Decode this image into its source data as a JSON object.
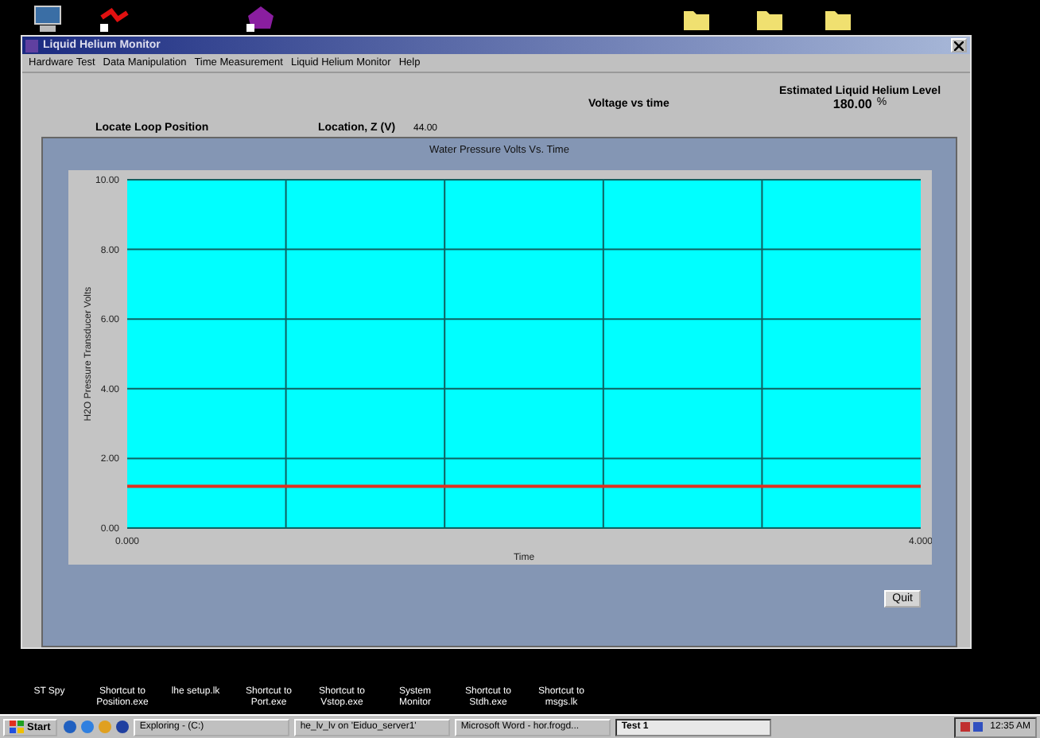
{
  "desktop_icons": [
    {
      "kind": "computer"
    },
    {
      "kind": "network"
    },
    {
      "kind": "app"
    },
    {
      "kind": "folder"
    },
    {
      "kind": "folder"
    },
    {
      "kind": "folder"
    }
  ],
  "window": {
    "title": "Liquid Helium Monitor",
    "menu": [
      "Hardware Test",
      "Data Manipulation",
      "Time Measurement",
      "Liquid Helium Monitor",
      "Help"
    ]
  },
  "header": {
    "locate_label": "Locate Loop Position",
    "location_label": "Location, Z (V)",
    "location_value": "44.00",
    "voltage_label": "Voltage vs time",
    "level_label": "Estimated Liquid Helium Level",
    "level_value": "180.00",
    "level_unit": "%"
  },
  "chart_data": {
    "type": "line",
    "title": "Water Pressure Volts Vs. Time",
    "xlabel": "Time",
    "ylabel": "H2O Pressure Transducer Volts",
    "x": [
      0,
      4
    ],
    "grid": true,
    "series": [
      {
        "color": "#e03020",
        "values": [
          1.2,
          1.2
        ]
      }
    ],
    "xlim": [
      0,
      4
    ],
    "ylim": [
      0,
      10
    ],
    "xticks": [
      {
        "value": 0,
        "label": "0.000"
      },
      {
        "value": 4,
        "label": "4.000"
      }
    ],
    "yticks": [
      {
        "value": 0,
        "label": "0.00"
      },
      {
        "value": 2,
        "label": "2.00"
      },
      {
        "value": 4,
        "label": "4.00"
      },
      {
        "value": 6,
        "label": "6.00"
      },
      {
        "value": 8,
        "label": "8.00"
      },
      {
        "value": 10,
        "label": "10.00"
      }
    ]
  },
  "quit_button": "Quit",
  "desktop_labels": [
    "ST Spy",
    "Shortcut to Position.exe",
    "lhe setup.lk",
    "Shortcut to Port.exe",
    "Shortcut to Vstop.exe",
    "System Monitor",
    "Shortcut to Stdh.exe",
    "Shortcut to msgs.lk"
  ],
  "taskbar": {
    "start": "Start",
    "tasks": [
      {
        "label": "Exploring - (C:)",
        "selected": false
      },
      {
        "label": "he_lv_lv on 'Eiduo_server1'",
        "selected": false
      },
      {
        "label": "Microsoft Word - hor.frogd...",
        "selected": false
      },
      {
        "label": "Test 1",
        "selected": true
      }
    ],
    "clock": "12:35 AM"
  }
}
